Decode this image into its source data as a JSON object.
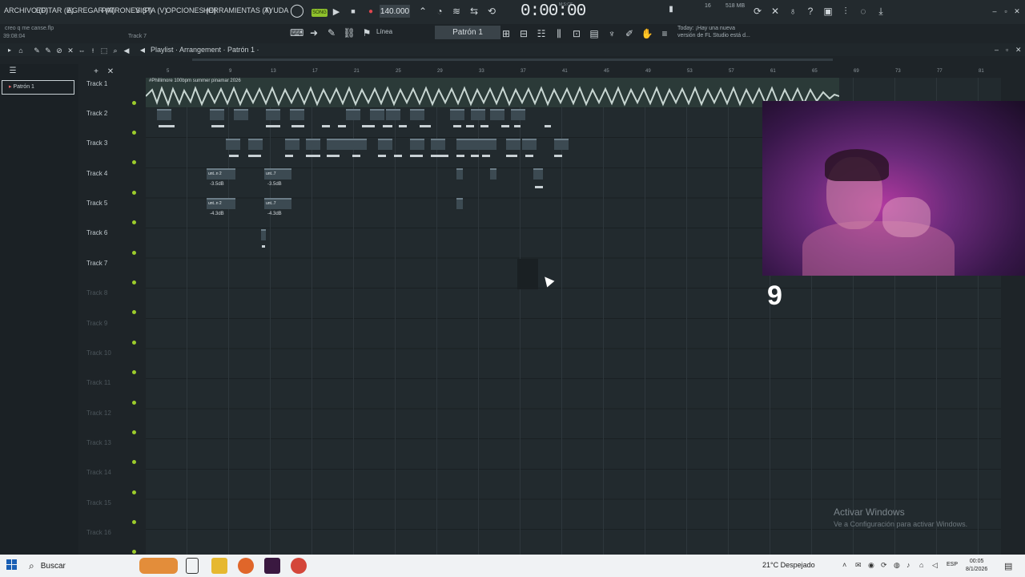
{
  "menu": [
    "ARCHIVO (F)",
    "EDITAR (E)",
    "AGREGAR (A)",
    "PATRONES (P)",
    "VISTA (V)",
    "OPCIONES (O)",
    "HERRAMIENTAS (T)",
    "AYUDA"
  ],
  "project": {
    "name": "creo q me canse.flp",
    "duration": "39:08:04"
  },
  "transport": {
    "song_label": "SONG",
    "tempo": "140.000",
    "time": "0:00:00",
    "time_unit": "M:S:CS"
  },
  "resources": {
    "cpu": "16",
    "memory": "518 MB",
    "memory_sub": "0"
  },
  "news": {
    "line1": "Today: ¡Hay una nueva",
    "line2": "versión de FL Studio está d..."
  },
  "toolbar": {
    "snap": "Línea",
    "pattern": "Patrón 1",
    "track_hint": "Track 7"
  },
  "playlist": {
    "breadcrumb": "Playlist · Arrangement · Patrón 1 ·"
  },
  "picker": {
    "item": "Patrón 1"
  },
  "tracks": [
    "Track 1",
    "Track 2",
    "Track 3",
    "Track 4",
    "Track 5",
    "Track 6",
    "Track 7",
    "Track 8",
    "Track 9",
    "Track 10",
    "Track 11",
    "Track 12",
    "Track 13",
    "Track 14",
    "Track 15",
    "Track 16"
  ],
  "ruler": [
    "5",
    "9",
    "13",
    "17",
    "21",
    "25",
    "29",
    "33",
    "37",
    "41",
    "45",
    "49",
    "53",
    "57",
    "61",
    "65",
    "69",
    "73",
    "77",
    "81"
  ],
  "audio_clip": {
    "name": "#Phillimore 100bpm summer pinamar 2026"
  },
  "clips": {
    "track4": [
      "unt..n 2",
      "unt..7",
      "-3.5dB",
      "-3.5dB"
    ],
    "track5": [
      "unt..n 2",
      "unt..7",
      "-4.3dB",
      "-4.3dB"
    ]
  },
  "overlay_number": "9",
  "watermark": {
    "title": "Activar Windows",
    "subtitle": "Ve a Configuración para activar Windows."
  },
  "taskbar": {
    "search": "Buscar",
    "weather": "21°C  Despejado",
    "lang": "ESP",
    "time": "00:05",
    "date": "8/1/2026"
  }
}
